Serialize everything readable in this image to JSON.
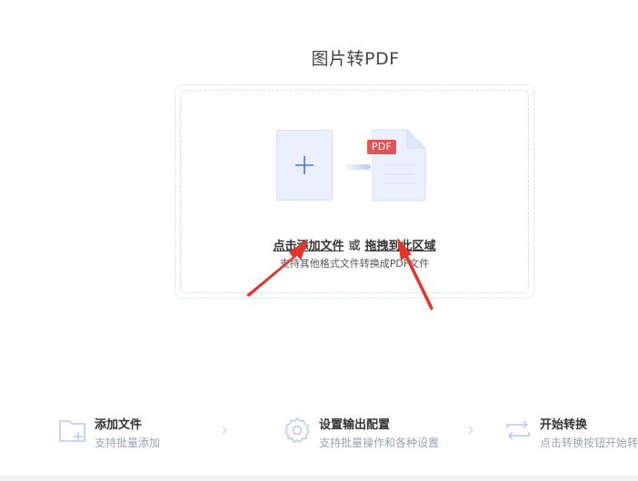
{
  "page": {
    "title": "图片转PDF"
  },
  "drop_zone": {
    "click_add": "点击添加文件",
    "or": "或",
    "drag_here": "拖拽到此区域",
    "subtitle": "支持其他格式文件转换成PDF文件",
    "pdf_badge": "PDF"
  },
  "steps": [
    {
      "title": "添加文件",
      "desc": "支持批量添加",
      "icon": "folder-add-icon"
    },
    {
      "title": "设置输出配置",
      "desc": "支持批量操作和各种设置",
      "icon": "gear-icon"
    },
    {
      "title": "开始转换",
      "desc": "点击转换按钮开始转",
      "icon": "convert-icon"
    }
  ],
  "colors": {
    "accent": "#3a78e7",
    "card_bg": "#eaf0fd",
    "pdf_badge": "#e25353",
    "annotation_arrow": "#e8332a",
    "icon_blue": "#b5c9f2"
  }
}
